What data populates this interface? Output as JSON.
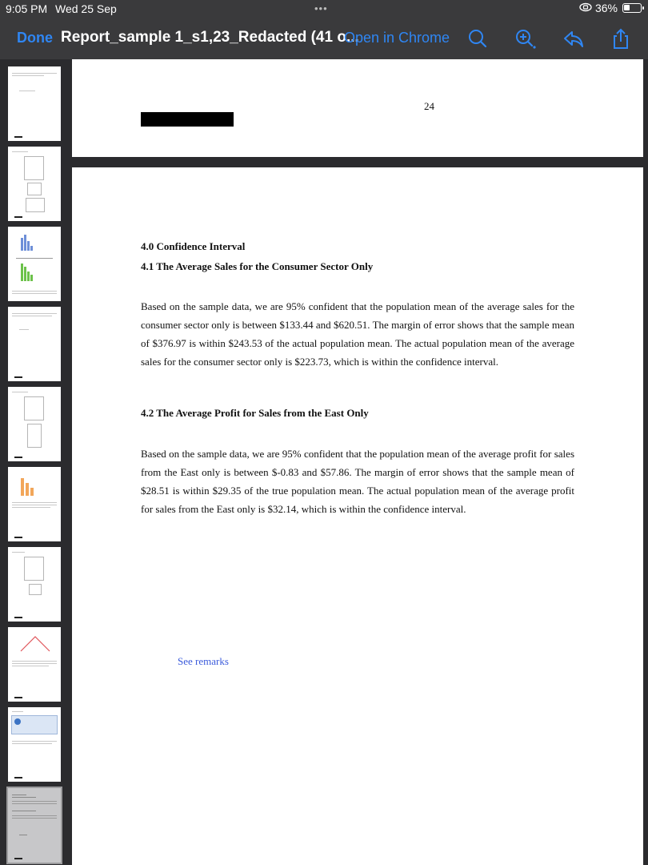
{
  "status_bar": {
    "time": "9:05 PM",
    "date": "Wed 25 Sep",
    "dots": "•••",
    "battery": "36%"
  },
  "toolbar": {
    "done_label": "Done",
    "title": "Report_sample 1_s1,23_Redacted (41 o...",
    "open_in_label": "Open in Chrome",
    "icons": [
      "search-icon",
      "zoom-in-icon",
      "reply-icon",
      "share-icon"
    ],
    "accent_color": "#2f86f3"
  },
  "sidebar": {
    "thumbnail_count": 10,
    "selected_index": 9
  },
  "document": {
    "previous_page_number": "24",
    "heading_main": "4.0 Confidence Interval",
    "section1_heading": "4.1 The Average Sales for the Consumer Sector Only",
    "section1_text": "Based on the sample data, we are 95% confident that the population mean of the average sales for the consumer sector only is between $133.44 and $620.51. The margin of error shows that the sample mean of $376.97 is within $243.53 of the actual population mean. The actual population mean of the average sales for the consumer sector only is $223.73, which is within the confidence interval.",
    "section2_heading": "4.2 The Average Profit for Sales from the East Only",
    "section2_text": "Based on the sample data, we are 95% confident that the population mean of the average profit for sales from the East only is between $-0.83 and $57.86. The margin of error shows that the sample mean of $28.51 is within $29.35 of the true population mean. The actual population mean of the average profit for sales from the East only is $32.14, which is within the confidence interval.",
    "remarks_link": "See remarks"
  }
}
